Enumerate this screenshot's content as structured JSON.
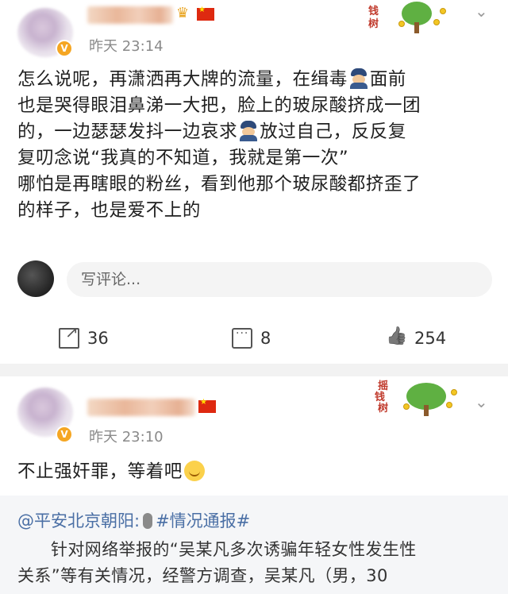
{
  "colors": {
    "background": "#f2f2f2",
    "card": "#ffffff",
    "timestamp": "#8a8a8a",
    "link": "#4a6fa5",
    "badge": "#f5a623",
    "flag": "#de2910"
  },
  "post1": {
    "time": "昨天 23:14",
    "text_line1_a": "怎么说呢，再潇洒再大牌的流量，在缉毒",
    "text_line1_b": "面前",
    "text_line2": "也是哭得眼泪鼻涕一大把，脸上的玻尿酸挤成一团",
    "text_line3_a": "的，一边瑟瑟发抖一边哀求",
    "text_line3_b": "放过自己，反反复",
    "text_line4": "复叨念说“我真的不知道，我就是第一次”",
    "text_line5": "哪怕是再瞎眼的粉丝，看到他那个玻尿酸都挤歪了",
    "text_line6": "的样子，也是爱不上的",
    "comment_placeholder": "写评论...",
    "share_count": "36",
    "comment_count": "8",
    "like_count": "254",
    "badge_chars": [
      "钱",
      "树"
    ],
    "icons": [
      "verified-badge",
      "crown-icon",
      "flag-icon",
      "police-emoji",
      "share-icon",
      "comment-icon",
      "like-icon",
      "chevron-down-icon"
    ]
  },
  "post2": {
    "time": "昨天 23:10",
    "text": "不止强奸罪，等着吧",
    "badge_chars": [
      "摇",
      "钱",
      "树"
    ],
    "quote": {
      "mention": "@平安北京朝阳:",
      "topic": "#情况通报#",
      "line1": "针对网络举报的“吴某凡多次诱骗年轻女性发生性",
      "line2": "关系”等有关情况，经警方调查，吴某凡（男，30"
    }
  }
}
